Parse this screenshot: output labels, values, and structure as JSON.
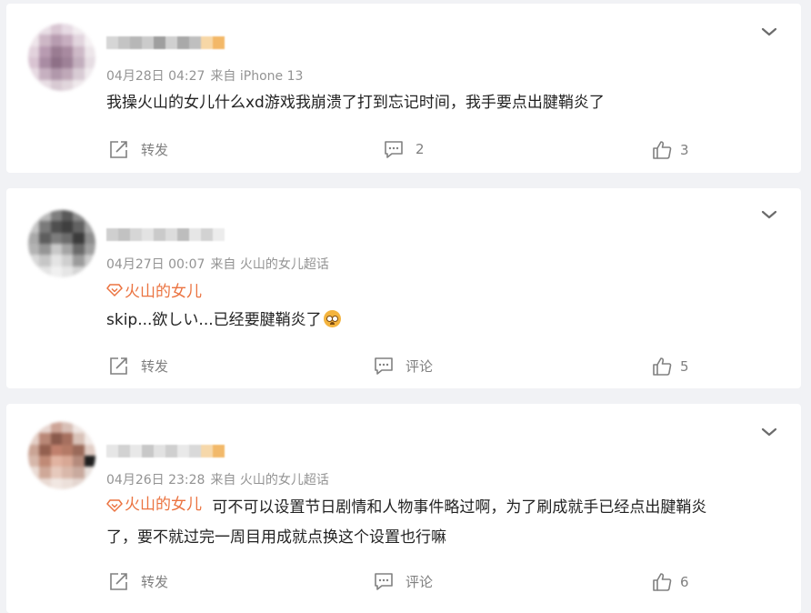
{
  "comments": [
    {
      "meta_time": "04月28日 04:27",
      "meta_source": "来自 iPhone 13",
      "topic": "",
      "text_line1": "我操火山的女儿什么xd游戏我崩溃了打到忘记时间，我手要点出腱鞘炎了",
      "text_line2": "",
      "repost_label": "转发",
      "comment_label": "2",
      "like_count": "3"
    },
    {
      "meta_time": "04月27日 00:07",
      "meta_source": "来自 火山的女儿超话",
      "topic": "火山的女儿",
      "text_line1": "skip...欲しい...已经要腱鞘炎了",
      "text_line2": "",
      "repost_label": "转发",
      "comment_label": "评论",
      "like_count": "5"
    },
    {
      "meta_time": "04月26日 23:28",
      "meta_source": "来自 火山的女儿超话",
      "topic": "火山的女儿",
      "text_line1": "可不可以设置节日剧情和人物事件略过啊，为了刷成就手已经点出腱鞘炎",
      "text_line2": "了，要不就过完一周目用成就点换这个设置也行嘛",
      "repost_label": "转发",
      "comment_label": "评论",
      "like_count": "6"
    }
  ],
  "colors": {
    "background": "#f1f2f5",
    "card": "#ffffff",
    "topic_orange": "#eb7340",
    "meta_gray": "#939393",
    "action_gray": "#808080"
  },
  "icons": [
    "chevron-down-icon",
    "repost-icon",
    "comment-icon",
    "like-icon",
    "topic-icon",
    "emoji-icon"
  ]
}
